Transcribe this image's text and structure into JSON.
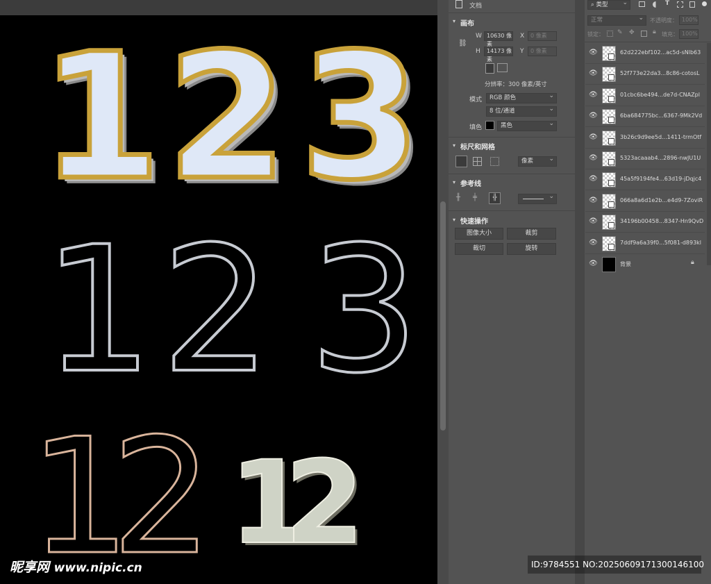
{
  "canvas": {
    "digits_row1": [
      "1",
      "2",
      "3"
    ],
    "digits_row2": [
      "1",
      "2",
      "3"
    ],
    "digits_row3": [
      "1",
      "2",
      "1",
      "2"
    ]
  },
  "watermark": {
    "brand": "昵享网",
    "site": "www.nipic.cn",
    "id": "ID:9784551 NO:20250609171300146100"
  },
  "properties": {
    "doc_tab": "文档",
    "canvas_section": {
      "title": "画布",
      "w_label": "W",
      "w_value": "10630 像素",
      "x_label": "X",
      "x_placeholder": "0 像素",
      "h_label": "H",
      "h_value": "14173 像素",
      "y_label": "Y",
      "y_placeholder": "0 像素",
      "resolution": "分辨率：300 像素/英寸",
      "mode_label": "模式",
      "mode_value": "RGB 颜色",
      "depth_value": "8 位/通道",
      "fill_label": "填色",
      "fill_value": "黑色",
      "fill_color": "#000000"
    },
    "rulers_section": {
      "title": "标尺和网格",
      "units_value": "像素"
    },
    "guides_section": {
      "title": "参考线"
    },
    "quick_actions": {
      "title": "快速操作",
      "buttons": [
        "图像大小",
        "裁剪",
        "裁切",
        "旋转"
      ]
    }
  },
  "layers": {
    "filter_kind": "类型",
    "blend_mode": "正常",
    "opacity_label": "不透明度：",
    "opacity_value": "100%",
    "lock_label": "锁定：",
    "fill_label": "填充：",
    "fill_value": "100%",
    "items": [
      {
        "name": "62d222ebf102...ac5d-sNlb63"
      },
      {
        "name": "52f773e22da3...8c86-cotosL"
      },
      {
        "name": "01cbc6be494...de7d-CNAZpl"
      },
      {
        "name": "6ba684775bc...6367-9Mk2Vd"
      },
      {
        "name": "3b26c9d9ee5d...1411-trmOtf"
      },
      {
        "name": "5323acaaab4...2896-nwJU1U"
      },
      {
        "name": "45a5f9194fe4...63d19-jDqjc4"
      },
      {
        "name": "066a8a6d1e2b...e4d9-7ZoviR"
      },
      {
        "name": "34196b00458...8347-Hn9QvD"
      },
      {
        "name": "7ddf9a6a39f0...5f081-d893kl"
      }
    ],
    "background_name": "背景"
  }
}
